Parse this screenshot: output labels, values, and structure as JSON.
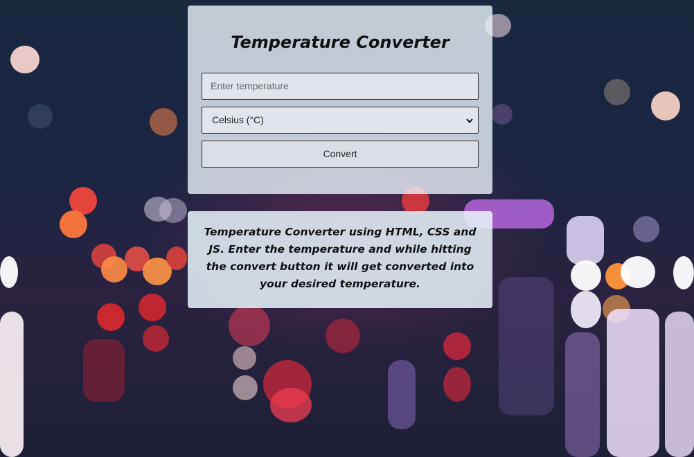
{
  "converter": {
    "title": "Temperature Converter",
    "input_placeholder": "Enter temperature",
    "unit_selected": "Celsius (°C)",
    "chevron_icon": "chevron-down-icon",
    "convert_label": "Convert"
  },
  "info": {
    "description": "Temperature Converter using HTML, CSS and JS. Enter the temperature and while hitting the convert button it will get converted into your desired temperature."
  },
  "background": {
    "base_color": "#1a2038",
    "accent_colors": [
      "#f0453a",
      "#ff8a3d",
      "#b06cff",
      "#ffffff"
    ]
  }
}
